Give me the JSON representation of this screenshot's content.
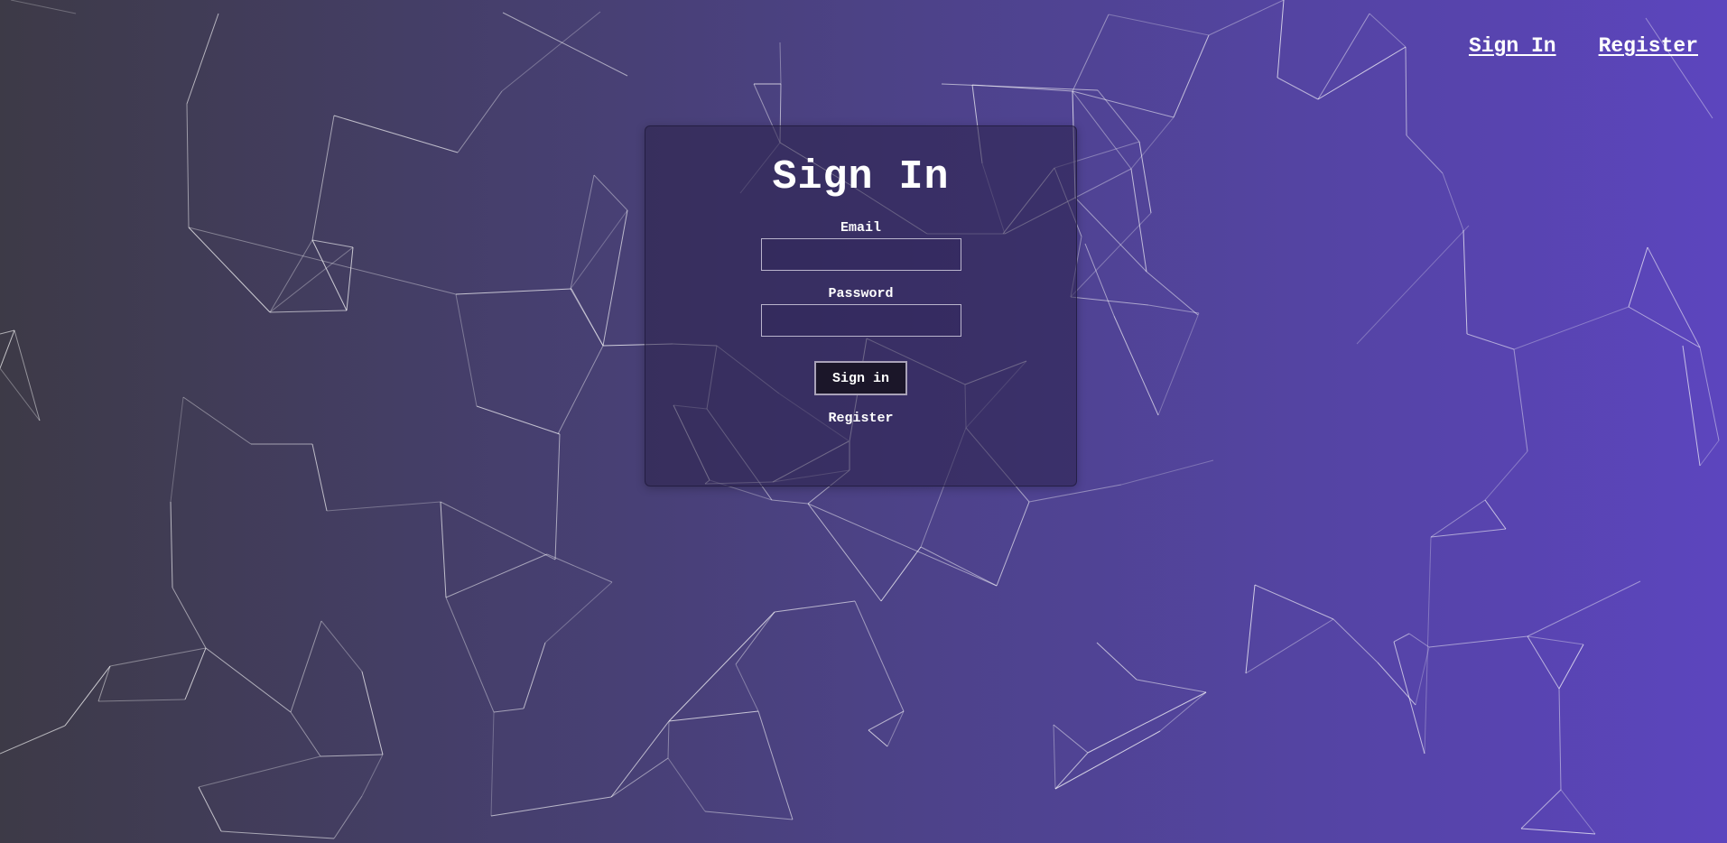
{
  "nav": {
    "sign_in_label": "Sign In",
    "register_label": "Register"
  },
  "form": {
    "title": "Sign In",
    "email_label": "Email",
    "email_value": "",
    "password_label": "Password",
    "password_value": "",
    "submit_label": "Sign in",
    "register_link_label": "Register"
  },
  "colors": {
    "gradient_start": "#3d3a47",
    "gradient_end": "#5c45be",
    "card_background": "#2a2048",
    "button_background": "#1b1629"
  }
}
